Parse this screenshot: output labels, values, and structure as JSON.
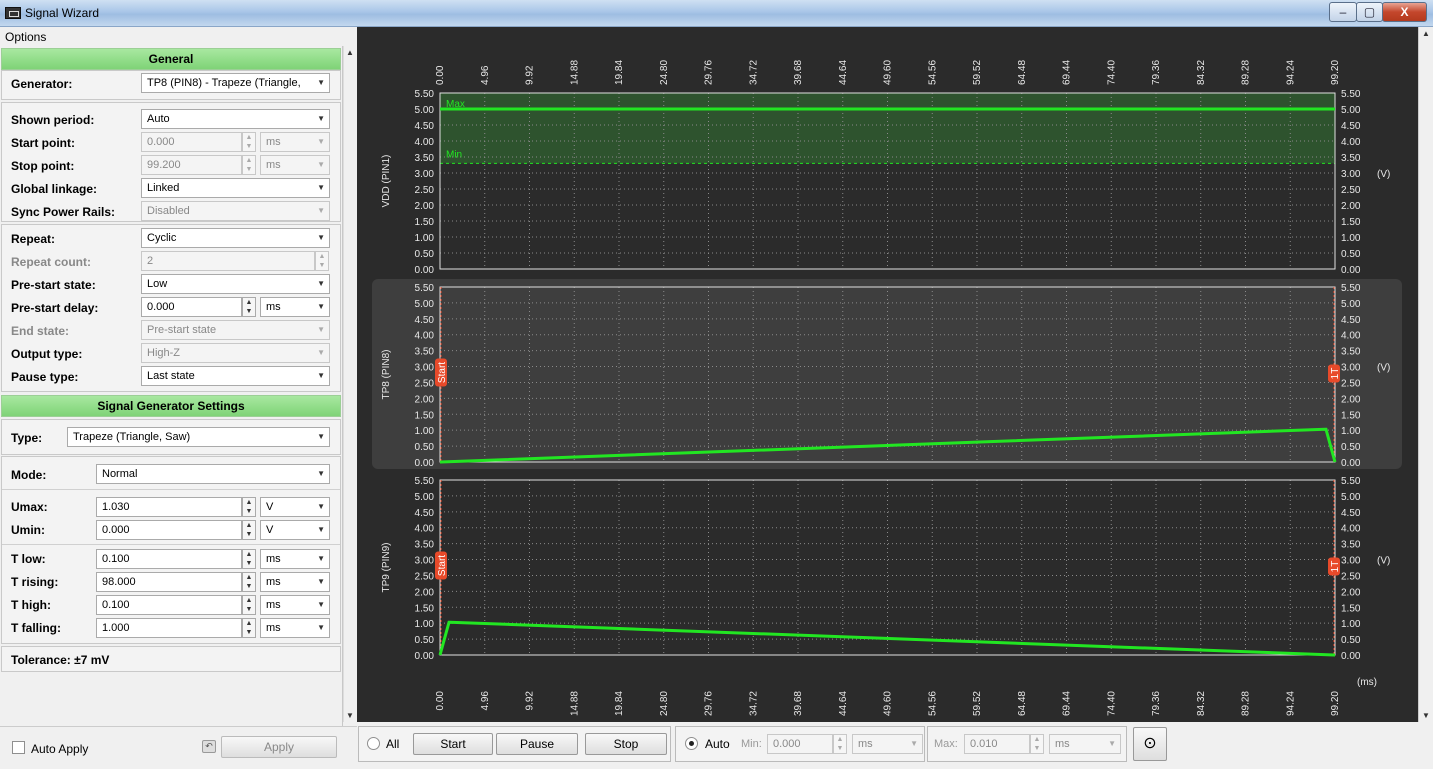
{
  "window": {
    "title": "Signal Wizard",
    "min": "–",
    "max": "▢",
    "close": "X"
  },
  "menu": {
    "options": "Options"
  },
  "general": {
    "header": "General",
    "generator_label": "Generator:",
    "generator_value": "TP8 (PIN8) - Trapeze (Triangle,",
    "shown_period_label": "Shown period:",
    "shown_period_value": "Auto",
    "start_point_label": "Start point:",
    "start_point_value": "0.000",
    "start_point_unit": "ms",
    "stop_point_label": "Stop point:",
    "stop_point_value": "99.200",
    "stop_point_unit": "ms",
    "global_linkage_label": "Global linkage:",
    "global_linkage_value": "Linked",
    "sync_power_label": "Sync Power Rails:",
    "sync_power_value": "Disabled",
    "repeat_label": "Repeat:",
    "repeat_value": "Cyclic",
    "repeat_count_label": "Repeat count:",
    "repeat_count_value": "2",
    "pre_start_state_label": "Pre-start state:",
    "pre_start_state_value": "Low",
    "pre_start_delay_label": "Pre-start delay:",
    "pre_start_delay_value": "0.000",
    "pre_start_delay_unit": "ms",
    "end_state_label": "End state:",
    "end_state_value": "Pre-start state",
    "output_type_label": "Output type:",
    "output_type_value": "High-Z",
    "pause_type_label": "Pause type:",
    "pause_type_value": "Last state"
  },
  "sg": {
    "header": "Signal Generator Settings",
    "type_label": "Type:",
    "type_value": "Trapeze (Triangle, Saw)",
    "mode_label": "Mode:",
    "mode_value": "Normal",
    "umax_label": "Umax:",
    "umax_value": "1.030",
    "umax_unit": "V",
    "umin_label": "Umin:",
    "umin_value": "0.000",
    "umin_unit": "V",
    "tlow_label": "T low:",
    "tlow_value": "0.100",
    "tlow_unit": "ms",
    "trising_label": "T rising:",
    "trising_value": "98.000",
    "trising_unit": "ms",
    "thigh_label": "T high:",
    "thigh_value": "0.100",
    "thigh_unit": "ms",
    "tfalling_label": "T falling:",
    "tfalling_value": "1.000",
    "tfalling_unit": "ms",
    "tolerance": "Tolerance: ±7 mV"
  },
  "bottom_left": {
    "auto_apply": "Auto Apply",
    "apply": "Apply"
  },
  "bottom_right": {
    "all": "All",
    "start": "Start",
    "pause": "Pause",
    "stop": "Stop",
    "auto": "Auto",
    "min_label": "Min:",
    "min_value": "0.000",
    "min_unit": "ms",
    "max_label": "Max:",
    "max_value": "0.010",
    "max_unit": "ms"
  },
  "chart_data": {
    "type": "line",
    "x_ticks": [
      "0.00",
      "4.96",
      "9.92",
      "14.88",
      "19.84",
      "24.80",
      "29.76",
      "34.72",
      "39.68",
      "44.64",
      "49.60",
      "54.56",
      "59.52",
      "64.48",
      "69.44",
      "74.40",
      "79.36",
      "84.32",
      "89.28",
      "94.24",
      "99.20"
    ],
    "xlim": [
      0,
      99.2
    ],
    "x_unit": "(ms)",
    "y_ticks": [
      "5.50",
      "5.00",
      "4.50",
      "4.00",
      "3.50",
      "3.00",
      "2.50",
      "2.00",
      "1.50",
      "1.00",
      "0.50",
      "0.00"
    ],
    "ylim": [
      0,
      5.5
    ],
    "y_unit": "(V)",
    "grid": true,
    "line_color": "#22e622",
    "marker_color": "#e84a2a",
    "panels": [
      {
        "name": "VDD (PIN1)",
        "band_max_label": "Max",
        "band_min_label": "Min",
        "band": [
          3.3,
          5.5
        ],
        "x": [
          0,
          99.2
        ],
        "y": [
          5.0,
          5.0
        ]
      },
      {
        "name": "TP8 (PIN8)",
        "start_label": "Start",
        "end_label": "1T",
        "x": [
          0,
          0.1,
          98.1,
          98.2,
          99.2
        ],
        "y": [
          0,
          0,
          1.03,
          1.03,
          0
        ]
      },
      {
        "name": "TP9 (PIN9)",
        "start_label": "Start",
        "end_label": "1T",
        "x": [
          0,
          1.0,
          1.1,
          99.1,
          99.2
        ],
        "y": [
          0,
          1.03,
          1.03,
          0,
          0
        ]
      }
    ]
  }
}
